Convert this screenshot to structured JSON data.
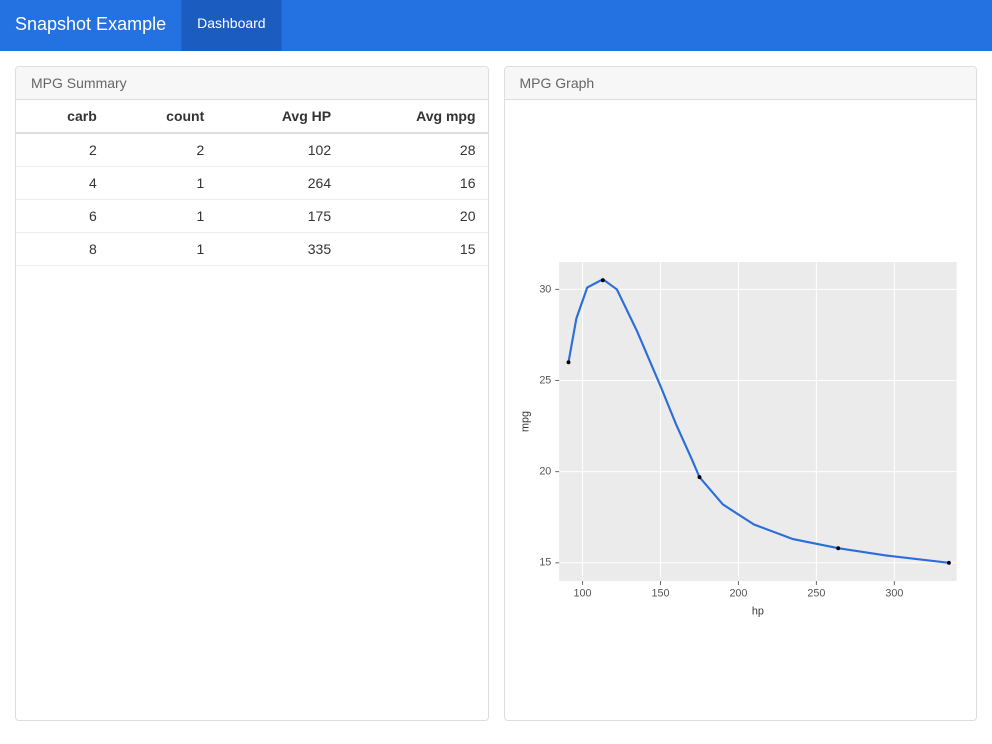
{
  "header": {
    "brand": "Snapshot Example",
    "tab_dashboard": "Dashboard"
  },
  "left_panel": {
    "heading": "MPG Summary",
    "columns": [
      "carb",
      "count",
      "Avg HP",
      "Avg mpg"
    ],
    "rows": [
      {
        "carb": 2,
        "count": 2,
        "avg_hp": 102,
        "avg_mpg": 28
      },
      {
        "carb": 4,
        "count": 1,
        "avg_hp": 264,
        "avg_mpg": 16
      },
      {
        "carb": 6,
        "count": 1,
        "avg_hp": 175,
        "avg_mpg": 20
      },
      {
        "carb": 8,
        "count": 1,
        "avg_hp": 335,
        "avg_mpg": 15
      }
    ]
  },
  "right_panel": {
    "heading": "MPG Graph"
  },
  "chart_data": {
    "type": "line",
    "xlabel": "hp",
    "ylabel": "mpg",
    "x_ticks": [
      100,
      150,
      200,
      250,
      300
    ],
    "y_ticks": [
      15,
      20,
      25,
      30
    ],
    "xlim": [
      85,
      340
    ],
    "ylim": [
      14,
      31.5
    ],
    "points": [
      {
        "hp": 91,
        "mpg": 26.0
      },
      {
        "hp": 113,
        "mpg": 30.5
      },
      {
        "hp": 175,
        "mpg": 19.7
      },
      {
        "hp": 264,
        "mpg": 15.8
      },
      {
        "hp": 335,
        "mpg": 15.0
      }
    ],
    "smooth_path": [
      {
        "hp": 91,
        "mpg": 26.0
      },
      {
        "hp": 96,
        "mpg": 28.4
      },
      {
        "hp": 103,
        "mpg": 30.1
      },
      {
        "hp": 113,
        "mpg": 30.55
      },
      {
        "hp": 122,
        "mpg": 30.0
      },
      {
        "hp": 135,
        "mpg": 27.7
      },
      {
        "hp": 150,
        "mpg": 24.7
      },
      {
        "hp": 160,
        "mpg": 22.6
      },
      {
        "hp": 170,
        "mpg": 20.7
      },
      {
        "hp": 175,
        "mpg": 19.7
      },
      {
        "hp": 190,
        "mpg": 18.2
      },
      {
        "hp": 210,
        "mpg": 17.1
      },
      {
        "hp": 235,
        "mpg": 16.3
      },
      {
        "hp": 264,
        "mpg": 15.8
      },
      {
        "hp": 295,
        "mpg": 15.4
      },
      {
        "hp": 335,
        "mpg": 15.0
      }
    ]
  }
}
